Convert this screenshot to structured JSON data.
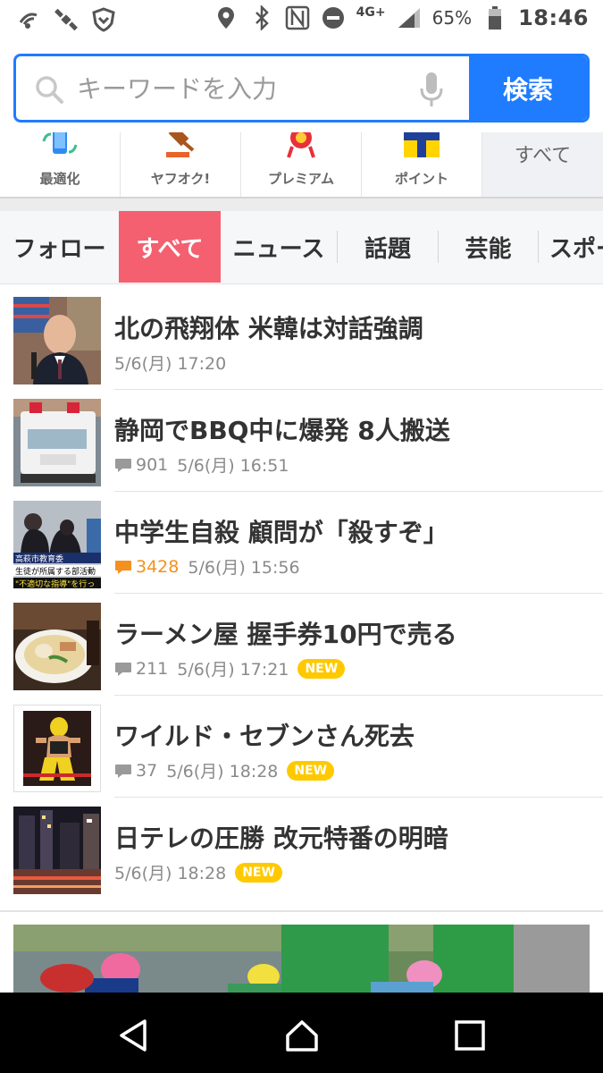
{
  "status_bar": {
    "network": "4G+",
    "battery": "65%",
    "time": "18:46"
  },
  "search": {
    "placeholder": "キーワードを入力",
    "button": "検索"
  },
  "quick_menu": [
    {
      "label": "最適化",
      "icon": "phone-refresh-icon"
    },
    {
      "label": "ヤフオク!",
      "icon": "auction-hammer-icon"
    },
    {
      "label": "プレミアム",
      "icon": "ribbon-icon"
    },
    {
      "label": "ポイント",
      "icon": "tpoint-icon"
    },
    {
      "label": "すべて"
    }
  ],
  "tabs": [
    {
      "label": "フォロー"
    },
    {
      "label": "すべて",
      "active": true
    },
    {
      "label": "ニュース"
    },
    {
      "label": "話題"
    },
    {
      "label": "芸能"
    },
    {
      "label": "スポー"
    }
  ],
  "news": [
    {
      "title": "北の飛翔体 米韓は対話強調",
      "date": "5/6(月) 17:20",
      "comments": "",
      "new": false,
      "hot": false
    },
    {
      "title": "静岡でBBQ中に爆発 8人搬送",
      "date": "5/6(月) 16:51",
      "comments": "901",
      "new": false,
      "hot": false
    },
    {
      "title": "中学生自殺 顧問が「殺すぞ」",
      "date": "5/6(月) 15:56",
      "comments": "3428",
      "new": false,
      "hot": true
    },
    {
      "title": "ラーメン屋 握手券10円で売る",
      "date": "5/6(月) 17:21",
      "comments": "211",
      "new": true,
      "hot": false
    },
    {
      "title": "ワイルド・セブンさん死去",
      "date": "5/6(月) 18:28",
      "comments": "37",
      "new": true,
      "hot": false
    },
    {
      "title": "日テレの圧勝 改元特番の明暗",
      "date": "5/6(月) 18:28",
      "comments": "",
      "new": true,
      "hot": false
    }
  ],
  "new_badge_label": "NEW",
  "thumb_overlay": {
    "line1": "高萩市教育委",
    "line2": "生徒が所属する部活動",
    "line3": "\"不適切な指導\"を行っ"
  },
  "colors": {
    "accent_blue": "#1f7cff",
    "active_tab": "#f4606f",
    "new_badge": "#ffc900",
    "hot_comment": "#f4911e"
  }
}
